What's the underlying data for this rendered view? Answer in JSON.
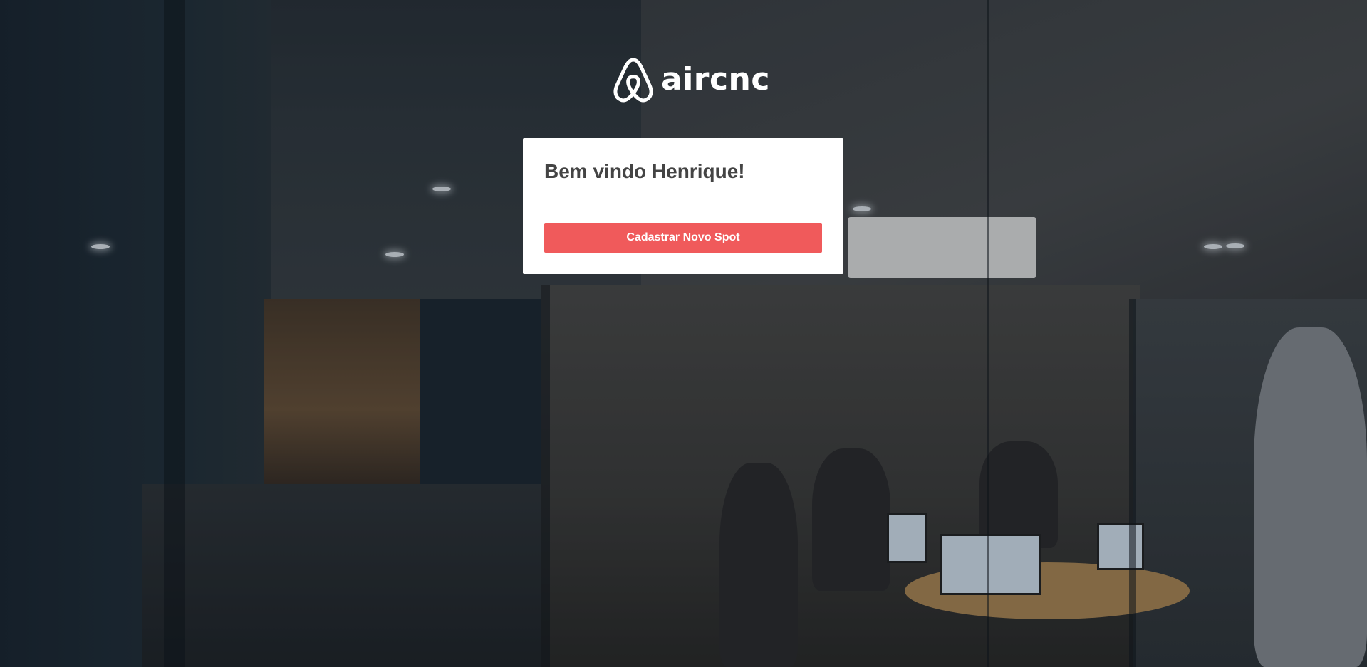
{
  "brand": {
    "logo_text": "aircnc",
    "icon": "airbnb-belo-icon"
  },
  "dashboard": {
    "welcome_title": "Bem vindo Henrique!",
    "new_spot_button_label": "Cadastrar Novo Spot"
  },
  "colors": {
    "accent": "#f05a5b",
    "card_background": "#ffffff",
    "title_text": "#444444"
  }
}
